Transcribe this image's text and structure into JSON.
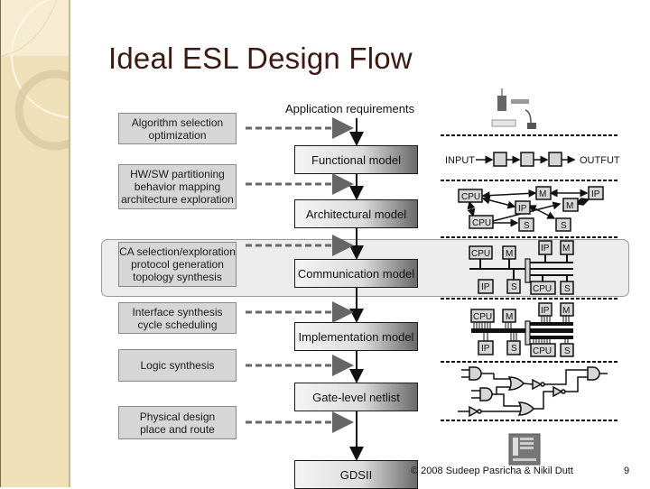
{
  "slide": {
    "title": "Ideal ESL Design Flow",
    "footer": "© 2008 Sudeep Pasricha  & Nikil Dutt",
    "page_number": "9"
  },
  "flow": {
    "top_label": "Application requirements",
    "tasks": [
      {
        "lines": [
          "Algorithm selection",
          "optimization"
        ]
      },
      {
        "lines": [
          "HW/SW partitioning",
          "behavior mapping",
          "architecture exploration"
        ]
      },
      {
        "lines": [
          "CA selection/exploration",
          "protocol generation",
          "topology synthesis"
        ]
      },
      {
        "lines": [
          "Interface synthesis",
          "cycle scheduling"
        ]
      },
      {
        "lines": [
          "Logic synthesis"
        ]
      },
      {
        "lines": [
          "Physical design",
          "place and route"
        ]
      }
    ],
    "models": [
      "Functional model",
      "Architectural model",
      "Communication model",
      "Implementation model",
      "Gate-level netlist",
      "GDSII"
    ],
    "highlighted_stage": "Communication model"
  },
  "illustrations": {
    "functional": {
      "input_label": "INPUT",
      "output_label": "OUTFUT"
    },
    "architectural": {
      "blocks": [
        "CPU",
        "M",
        "IP",
        "IP",
        "M",
        "CPU",
        "S",
        "S"
      ]
    },
    "communication": {
      "blocks": [
        "CPU",
        "M",
        "IP",
        "M",
        "IP",
        "S",
        "CPU",
        "S"
      ]
    },
    "implementation": {
      "blocks": [
        "CPU",
        "M",
        "IP",
        "M",
        "IP",
        "S",
        "CPU",
        "S"
      ]
    },
    "top_icon": "devices-icon",
    "bottom_icon": "chip-layout-icon"
  }
}
